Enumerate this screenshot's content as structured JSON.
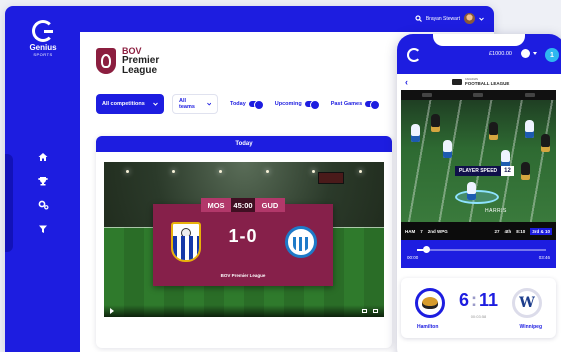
{
  "brand": {
    "name": "Genius",
    "sub": "SPORTS"
  },
  "sidebar": {
    "items": [
      {
        "icon": "home-icon"
      },
      {
        "icon": "trophy-icon"
      },
      {
        "icon": "settings-cog-icon"
      },
      {
        "icon": "filter-icon"
      }
    ]
  },
  "header": {
    "user_name": "Brayan Stewart"
  },
  "league": {
    "line1": "BOV",
    "line2": "Premier",
    "line3": "League"
  },
  "filters": {
    "competitions": "All competitions",
    "teams": "All teams",
    "today": "Today",
    "upcoming": "Upcoming",
    "past": "Past Games"
  },
  "today_card": {
    "title": "Today"
  },
  "match_overlay": {
    "home_code": "MOS",
    "time": "45:00",
    "away_code": "GUD",
    "score": "1-0",
    "league": "BOV Premier League"
  },
  "phone": {
    "balance": "£1000.00",
    "badge": "1",
    "cfl_line1": "CANADIAN",
    "cfl_line2": "FOOTBALL LEAGUE",
    "player_speed_label": "PLAYER SPEED",
    "player_speed_value": "12",
    "player_name": "HARRIS",
    "scorebar": {
      "home": "HAM",
      "home_score": "7",
      "mid": "2nd  WPG",
      "away_score": "27",
      "down": "4th",
      "distance": "8:10",
      "flag": "3rd & 10"
    },
    "progress": {
      "left_time": "00:00",
      "right_time": "03:46",
      "fraction": 0.07
    },
    "match": {
      "home": "Hamilton",
      "away": "Winnipeg",
      "home_score": "6",
      "away_score": "11",
      "clock": "00:03:58"
    }
  },
  "colors": {
    "brand_blue": "#1d1de0",
    "league_maroon": "#86204a",
    "accent_cyan": "#2eb7f0"
  }
}
